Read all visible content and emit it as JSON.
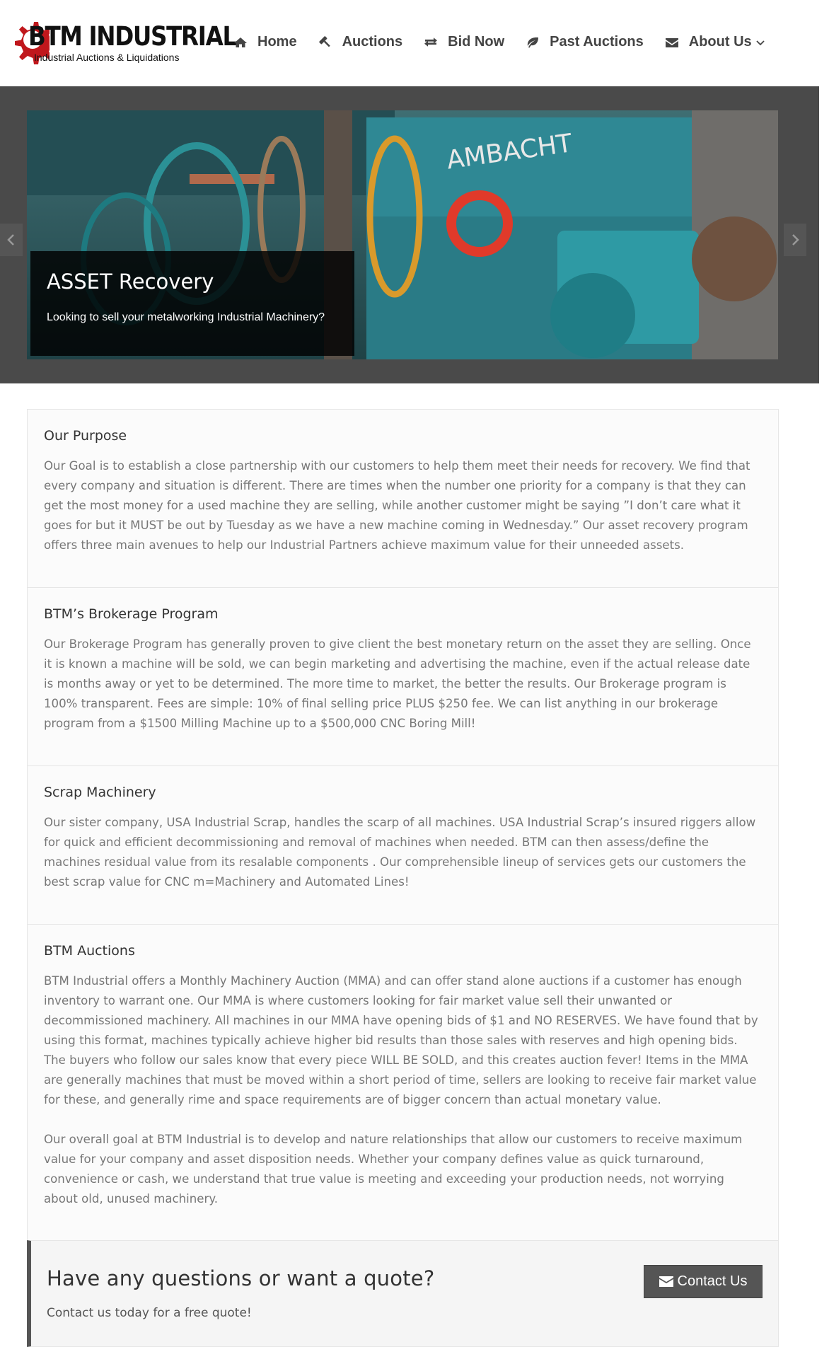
{
  "logo": {
    "brand": "BTM INDUSTRIAL",
    "tagline": "Industrial Auctions & Liquidations",
    "gear_color": "#c0171c"
  },
  "nav": {
    "items": [
      {
        "label": "Home",
        "icon": "home-icon"
      },
      {
        "label": "Auctions",
        "icon": "gavel-icon"
      },
      {
        "label": "Bid Now",
        "icon": "exchange-icon"
      },
      {
        "label": "Past Auctions",
        "icon": "leaf-icon"
      },
      {
        "label": "About Us",
        "icon": "envelope-icon",
        "dropdown": true
      }
    ]
  },
  "slider": {
    "title": "ASSET Recovery",
    "subtitle": "Looking to sell your metalworking Industrial Machinery?",
    "image_text": "AMBACHT"
  },
  "sections": [
    {
      "title": "Our Purpose",
      "paragraphs": [
        "Our Goal is to establish a close partnership with our customers to help them meet their needs for recovery. We find that every company and situation is different. There are times when the number one priority for a company is that they can get the most money for a used machine they are selling, while another customer might be saying ”I don’t care what it goes for but it MUST be out by Tuesday as we have a new machine coming in Wednesday.” Our asset recovery program offers three main avenues to help our Industrial Partners achieve maximum value for their unneeded assets."
      ]
    },
    {
      "title": "BTM’s Brokerage Program",
      "paragraphs": [
        "Our Brokerage Program has generally proven to give client the best monetary return on the asset they are selling. Once it is known a machine will be sold, we can begin marketing and advertising the machine, even if the actual release date is months away or yet to be determined. The more time to market, the better the results. Our Brokerage program is 100% transparent. Fees are simple: 10% of final selling price PLUS $250 fee. We can list anything in our brokerage program from a $1500 Milling Machine up to a $500,000 CNC Boring Mill!"
      ]
    },
    {
      "title": "Scrap Machinery",
      "paragraphs": [
        "Our sister company, USA Industrial Scrap, handles the scarp of all machines. USA Industrial Scrap’s insured riggers allow for quick and efficient decommissioning and removal of machines when needed. BTM can then assess/define the machines residual value from its resalable components . Our comprehensible lineup of services gets our customers the best scrap value for CNC m=Machinery and Automated Lines!"
      ]
    },
    {
      "title": "BTM Auctions",
      "paragraphs": [
        "BTM Industrial offers a Monthly Machinery Auction (MMA) and can offer stand alone auctions if a customer has enough inventory to warrant one. Our MMA is where customers looking for fair market value sell their unwanted or decommissioned machinery. All machines in our MMA have opening bids of $1 and NO RESERVES. We have found that by using this format, machines typically achieve higher bid results than those sales with reserves and high opening bids. The buyers who follow our sales know that every piece WILL BE SOLD, and this creates auction fever! Items in the MMA are generally machines that must be moved within a short period of time, sellers are looking to receive fair market value for these, and generally rime and space requirements are of bigger concern than actual monetary value.",
        "Our overall goal at BTM Industrial is to develop and nature relationships that allow our customers to receive maximum value for your company and asset disposition needs. Whether your company defines value as quick turnaround, convenience or cash, we understand that true value is meeting and exceeding your production needs, not worrying about old, unused machinery."
      ]
    }
  ],
  "cta": {
    "heading": "Have any questions or want a quote?",
    "text": "Contact us today for a free quote!",
    "button": "Contact Us"
  }
}
